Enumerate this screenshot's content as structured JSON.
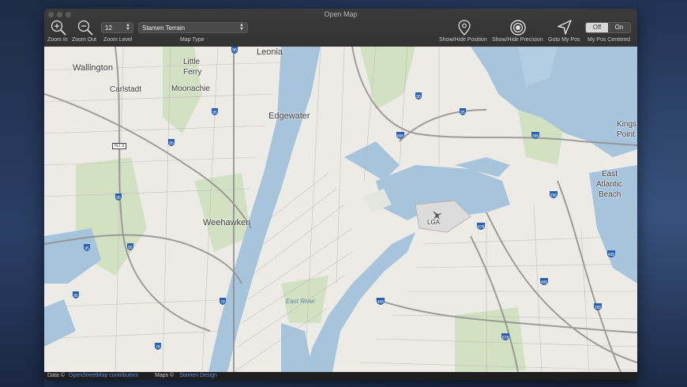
{
  "window": {
    "title": "Open Map"
  },
  "toolbar": {
    "zoom_in_label": "Zoom In",
    "zoom_out_label": "Zoom Out",
    "zoom_level_label": "Zoom Level",
    "zoom_level_value": "12",
    "map_type_label": "Map Type",
    "map_type_value": "Stamen Terrain",
    "show_position_label": "Show/Hide Position",
    "show_precision_label": "Show/Hide Precision",
    "goto_label": "Goto My Pos",
    "centered_label": "My Pos Centered",
    "centered_off": "Off",
    "centered_on": "On",
    "centered_selected": "Off"
  },
  "map": {
    "labels": {
      "wallington": "Wallington",
      "carlstadt": "Carlstadt",
      "little": "Little",
      "ferry": "Ferry",
      "moonachie": "Moonachie",
      "leonia": "Leonia",
      "edgewater": "Edgewater",
      "weehawken": "Weehawken",
      "kings": "Kings",
      "point": "Point",
      "east": "East",
      "atlantic": "Atlantic",
      "beach": "Beach",
      "east_river": "East River",
      "lga": "LGA",
      "nj3": "NJ 3"
    },
    "colors": {
      "land": "#ecebe6",
      "water": "#a7c4dd",
      "park": "#c5dab0",
      "road": "#9a9a9a"
    }
  },
  "footer": {
    "data_label": "Data ©",
    "data_link": "OpenStreetMap contributors",
    "maps_label": "Maps ©",
    "maps_link": "Stamen Design"
  }
}
